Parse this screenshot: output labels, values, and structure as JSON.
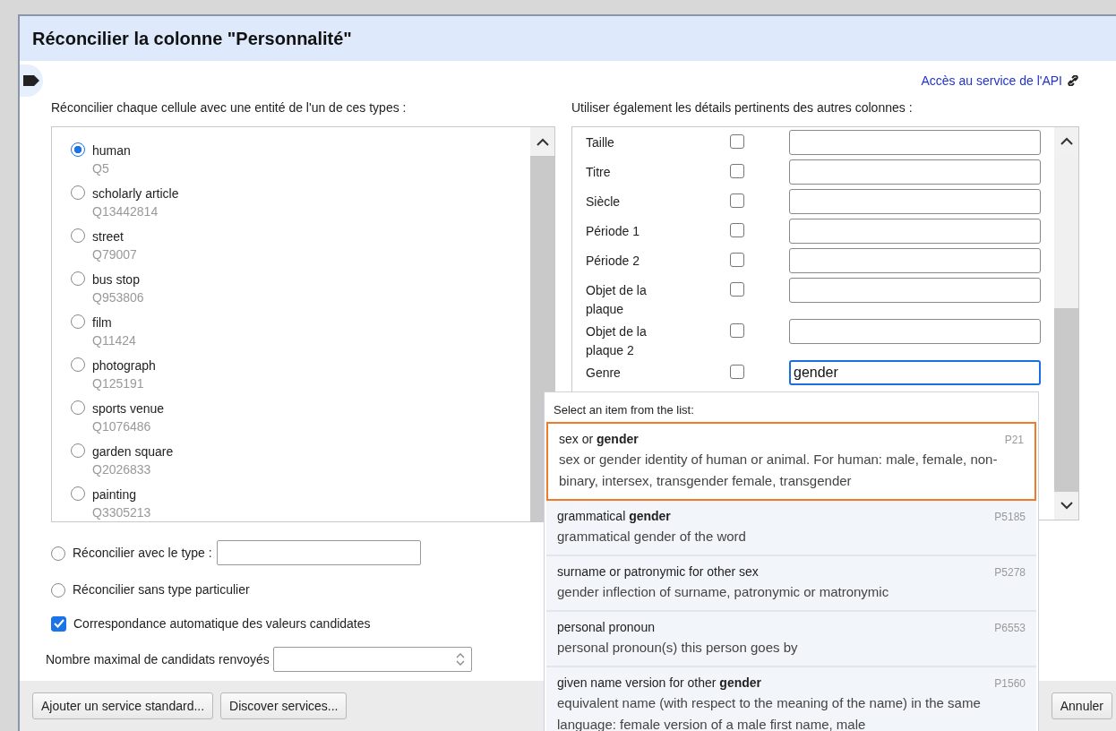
{
  "title": "Réconcilier la colonne \"Personnalité\"",
  "api_link": "Accès au service de l'API",
  "types_label": "Réconcilier chaque cellule avec une entité de l'un de ces types :",
  "types": [
    {
      "name": "human",
      "id": "Q5",
      "selected": true
    },
    {
      "name": "scholarly article",
      "id": "Q13442814",
      "selected": false
    },
    {
      "name": "street",
      "id": "Q79007",
      "selected": false
    },
    {
      "name": "bus stop",
      "id": "Q953806",
      "selected": false
    },
    {
      "name": "film",
      "id": "Q11424",
      "selected": false
    },
    {
      "name": "photograph",
      "id": "Q125191",
      "selected": false
    },
    {
      "name": "sports venue",
      "id": "Q1076486",
      "selected": false
    },
    {
      "name": "garden square",
      "id": "Q2026833",
      "selected": false
    },
    {
      "name": "painting",
      "id": "Q3305213",
      "selected": false
    }
  ],
  "type_option": {
    "label": "Réconcilier avec le type :",
    "selected": false
  },
  "no_type_option": {
    "label": "Réconcilier sans type particulier",
    "selected": false
  },
  "auto_match": {
    "label": "Correspondance automatique des valeurs candidates",
    "checked": true
  },
  "max_candidates": {
    "label": "Nombre maximal de candidats renvoyés"
  },
  "columns_label": "Utiliser également les détails pertinents des autres colonnes :",
  "columns": [
    {
      "name": "Taille",
      "checked": false
    },
    {
      "name": "Titre",
      "checked": false
    },
    {
      "name": "Siècle",
      "checked": false
    },
    {
      "name": "Période 1",
      "checked": false
    },
    {
      "name": "Période 2",
      "checked": false
    },
    {
      "name": "Objet de la plaque",
      "checked": false
    },
    {
      "name": "Objet de la plaque 2",
      "checked": false
    },
    {
      "name": "Genre",
      "checked": false,
      "value": "gender",
      "focused": true
    }
  ],
  "autocomplete": {
    "header": "Select an item from the list:",
    "items": [
      {
        "name": "sex or **gender**",
        "id": "P21",
        "description": "sex or gender identity of human or animal. For human: male, female, non-binary, intersex, transgender female, transgender",
        "selected": true
      },
      {
        "name": "grammatical **gender**",
        "id": "P5185",
        "description": "grammatical gender of the word",
        "selected": false
      },
      {
        "name": "surname or patronymic for other sex",
        "id": "P5278",
        "description": "gender inflection of surname, patronymic or matronymic",
        "selected": false
      },
      {
        "name": "personal pronoun",
        "id": "P6553",
        "description": "personal pronoun(s) this person goes by",
        "selected": false
      },
      {
        "name": "given name version for other **gender**",
        "id": "P1560",
        "description": "equivalent name (with respect to the meaning of the name) in the same language: female version of a male first name, male",
        "selected": false
      }
    ]
  },
  "footer_buttons": [
    "Ajouter un service standard...",
    "Discover services..."
  ],
  "cancel_button": "Annuler"
}
